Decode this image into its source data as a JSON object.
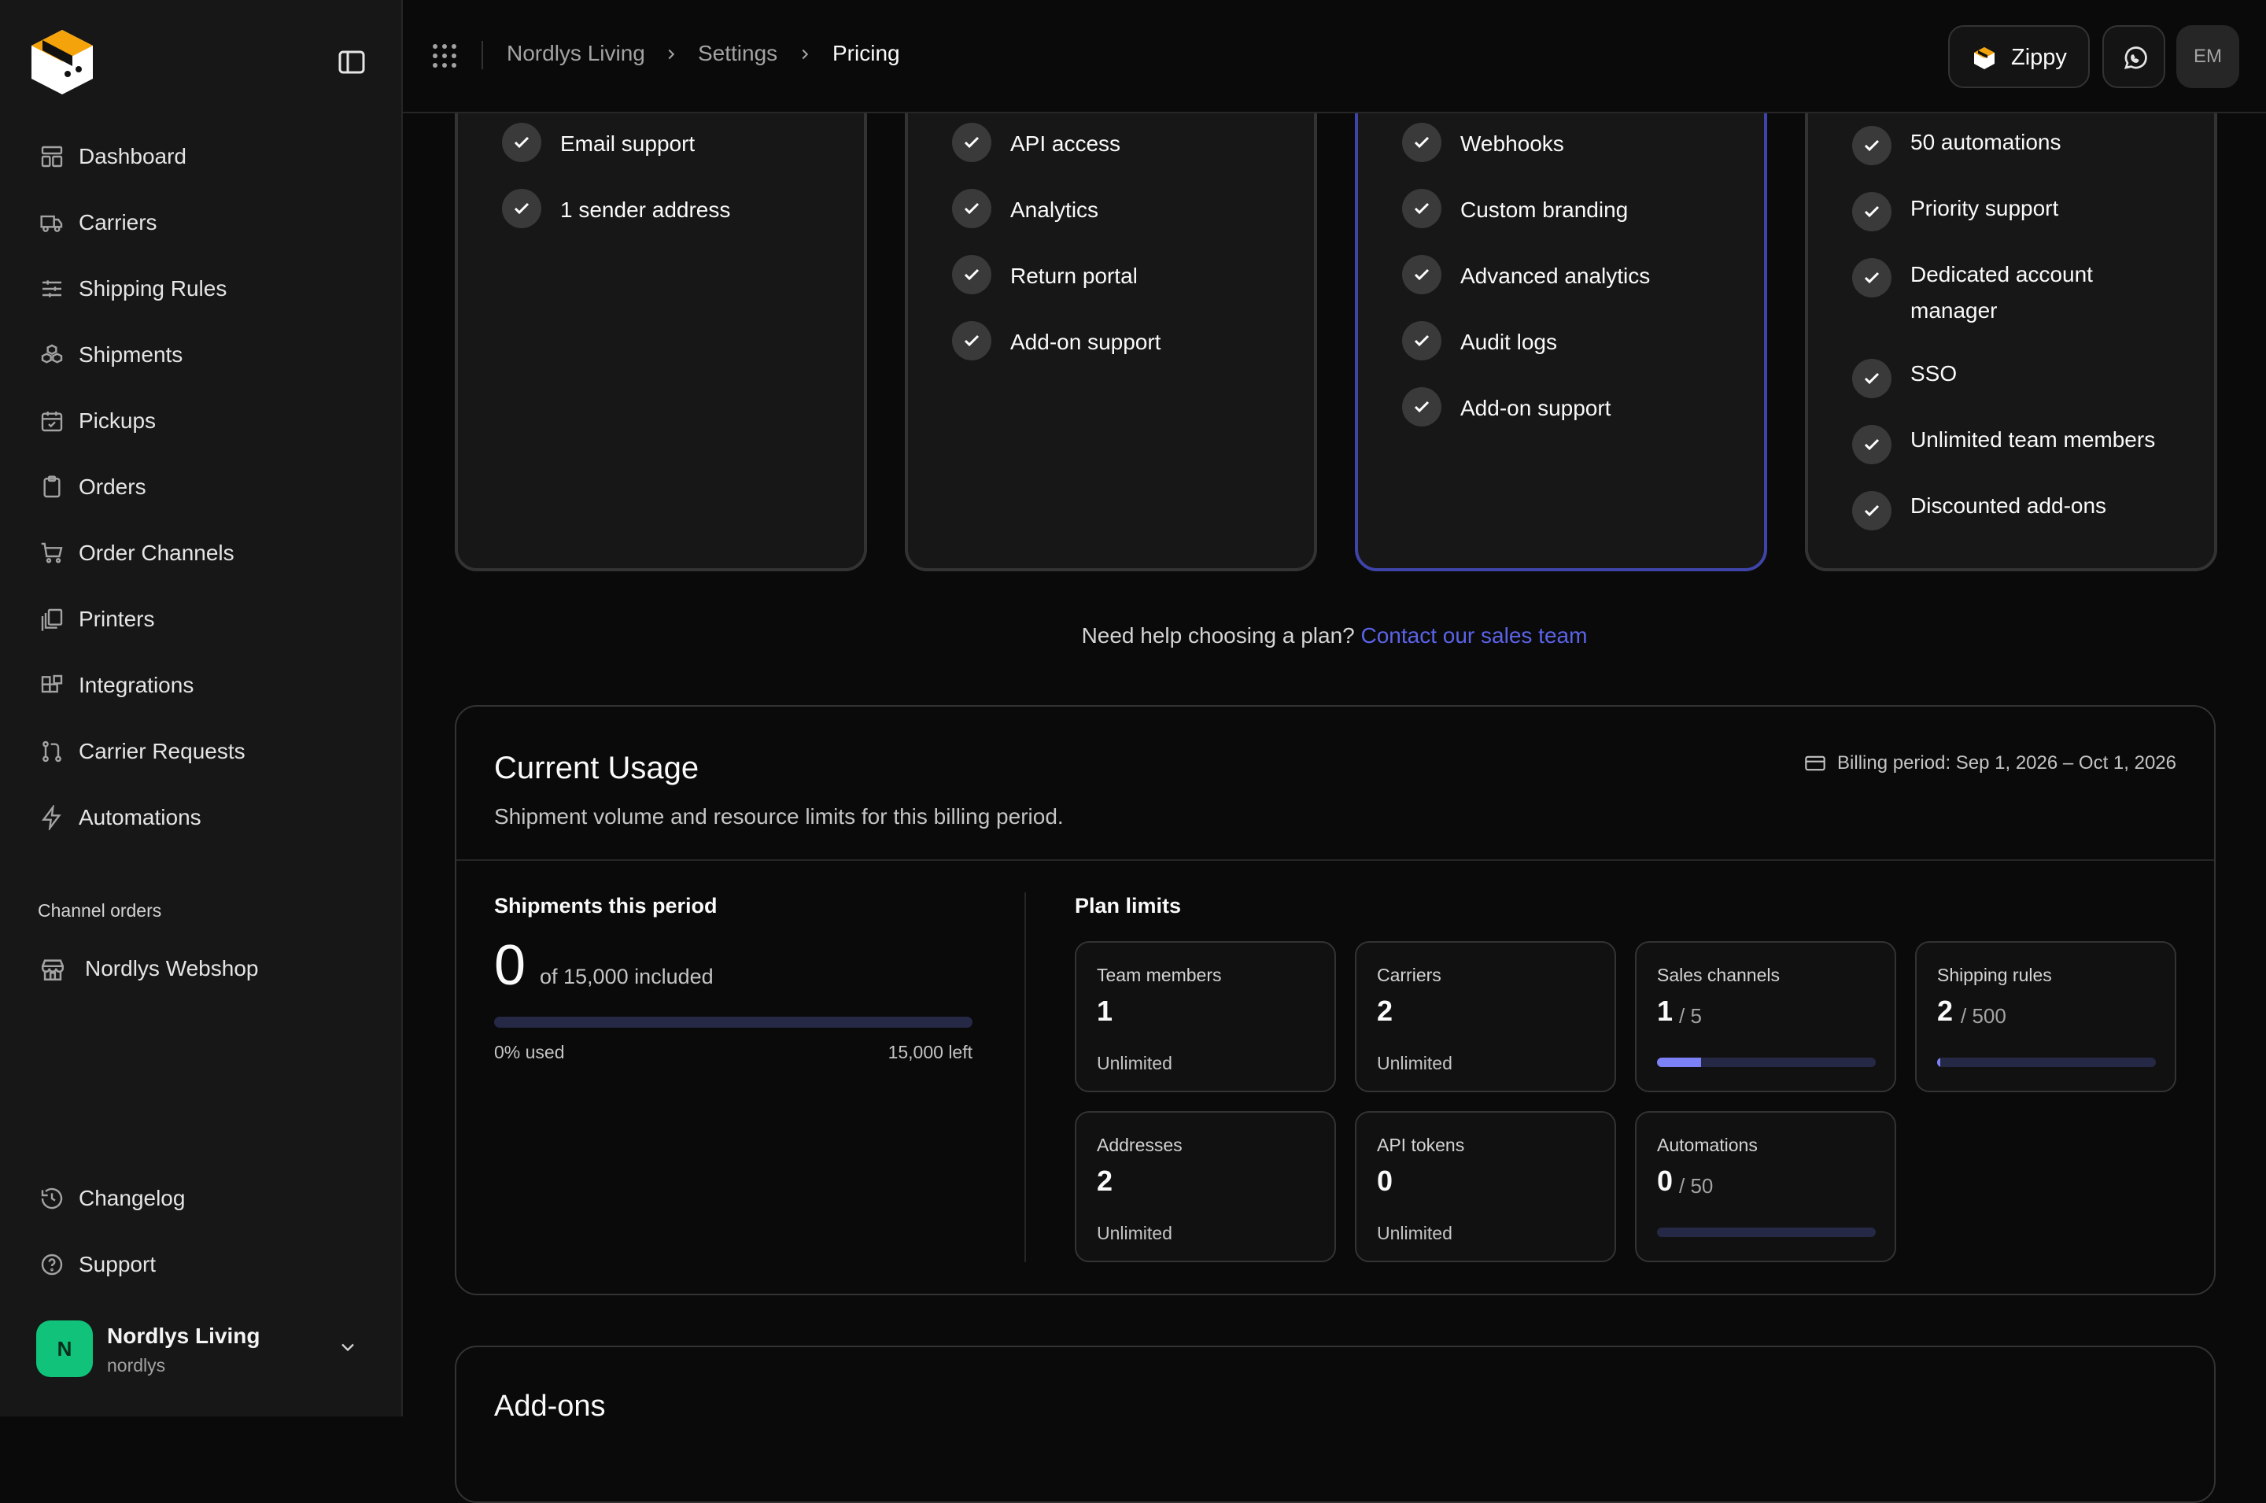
{
  "sidebar": {
    "nav": [
      {
        "label": "Dashboard",
        "icon": "dashboard-icon"
      },
      {
        "label": "Carriers",
        "icon": "truck-icon"
      },
      {
        "label": "Shipping Rules",
        "icon": "sliders-icon"
      },
      {
        "label": "Shipments",
        "icon": "boxes-icon"
      },
      {
        "label": "Pickups",
        "icon": "calendar-check-icon"
      },
      {
        "label": "Orders",
        "icon": "clipboard-icon"
      },
      {
        "label": "Order Channels",
        "icon": "cart-icon"
      },
      {
        "label": "Printers",
        "icon": "printer-icon"
      },
      {
        "label": "Integrations",
        "icon": "blocks-icon"
      },
      {
        "label": "Carrier Requests",
        "icon": "git-pull-icon"
      },
      {
        "label": "Automations",
        "icon": "bolt-icon"
      }
    ],
    "section_label": "Channel orders",
    "channel": "Nordlys Webshop",
    "bottom": [
      {
        "label": "Changelog",
        "icon": "history-icon"
      },
      {
        "label": "Support",
        "icon": "help-circle-icon"
      }
    ],
    "account": {
      "initial": "N",
      "name": "Nordlys Living",
      "slug": "nordlys"
    }
  },
  "topbar": {
    "breadcrumb": [
      "Nordlys Living",
      "Settings",
      "Pricing"
    ],
    "zippy_label": "Zippy",
    "avatar": "EM"
  },
  "plans": [
    {
      "features": [
        "Email support",
        "1 sender address"
      ]
    },
    {
      "features": [
        "API access",
        "Analytics",
        "Return portal",
        "Add-on support"
      ]
    },
    {
      "features": [
        "Webhooks",
        "Custom branding",
        "Advanced analytics",
        "Audit logs",
        "Add-on support"
      ]
    },
    {
      "features": [
        "50 automations",
        "Priority support",
        "Dedicated account manager",
        "SSO",
        "Unlimited team members",
        "Discounted add-ons"
      ]
    }
  ],
  "help": {
    "text": "Need help choosing a plan?",
    "link": "Contact our sales team"
  },
  "usage": {
    "title": "Current Usage",
    "subtitle": "Shipment volume and resource limits for this billing period.",
    "billing": "Billing period: Sep 1, 2026 – Oct 1, 2026",
    "shipments": {
      "label": "Shipments this period",
      "count": "0",
      "included": "of 15,000 included",
      "used_fraction": 0,
      "used_label": "0% used",
      "left_label": "15,000 left"
    },
    "limits_label": "Plan limits",
    "limits": [
      {
        "name": "Team members",
        "value": "1",
        "note": "Unlimited"
      },
      {
        "name": "Carriers",
        "value": "2",
        "note": "Unlimited"
      },
      {
        "name": "Sales channels",
        "value": "1",
        "max": "/ 5",
        "fraction": 0.2
      },
      {
        "name": "Shipping rules",
        "value": "2",
        "max": "/ 500",
        "fraction": 0.004
      },
      {
        "name": "Addresses",
        "value": "2",
        "note": "Unlimited"
      },
      {
        "name": "API tokens",
        "value": "0",
        "note": "Unlimited"
      },
      {
        "name": "Automations",
        "value": "0",
        "max": "/ 50",
        "fraction": 0
      }
    ]
  },
  "addons": {
    "title": "Add-ons"
  },
  "colors": {
    "accent": "#5b63e8",
    "success": "#10c27a",
    "highlight_border": "#3f44a8"
  }
}
